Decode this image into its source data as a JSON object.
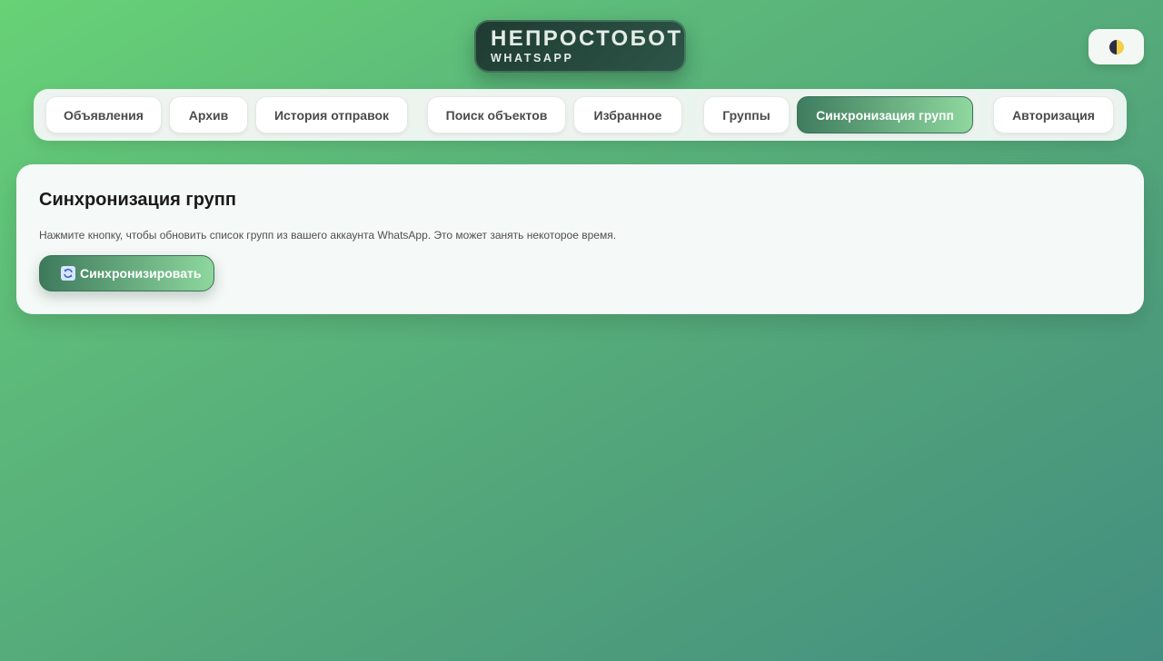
{
  "logo": {
    "title": "НЕПРОСТОБОТ",
    "subtitle": "WHATSAPP"
  },
  "theme_toggle": {
    "icon": "half-moon-icon"
  },
  "nav": {
    "tabs": [
      {
        "label": "Объявления"
      },
      {
        "label": "Архив"
      },
      {
        "label": "История отправок"
      },
      {
        "label": "Поиск объектов"
      },
      {
        "label": "Избранное"
      },
      {
        "label": "Группы"
      },
      {
        "label": "Синхронизация групп",
        "active": true
      },
      {
        "label": "Авторизация"
      }
    ]
  },
  "main": {
    "title": "Синхронизация групп",
    "description": "Нажмите кнопку, чтобы обновить список групп из вашего аккаунта WhatsApp. Это может занять некоторое время.",
    "sync_button_label": "Синхронизировать",
    "sync_button_icon": "refresh-icon"
  },
  "colors": {
    "accent_dark": "#3e7c5e",
    "accent_light": "#8fd89f",
    "background_top": "#67d276",
    "background_bottom": "#438e80"
  }
}
